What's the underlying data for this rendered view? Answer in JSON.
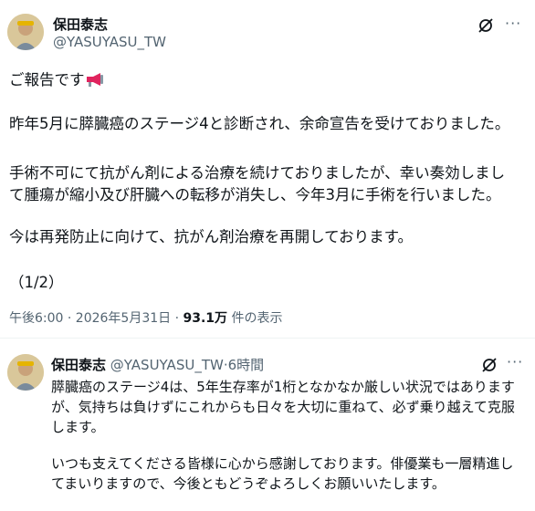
{
  "main_post": {
    "author_name": "保田泰志",
    "handle": "@YASUYASU_TW",
    "more_label": "···",
    "intro_text": "ご報告です",
    "intro_emoji_icon": "megaphone-icon",
    "lines": [
      "昨年5月に膵臓癌のステージ4と診断され、余命宣告を受けておりました。",
      "",
      "手術不可にて抗がん剤による治療を続けておりましたが、幸い奏効しまし",
      "て腫瘍が縮小及び肝臓への転移が消失し、今年3月に手術を行いました。",
      "",
      "今は再発防止に向けて、抗がん剤治療を再開しております。",
      "",
      "（1/2）"
    ],
    "timestamp": "午後6:00 · 2026年5月31日",
    "dot": "·",
    "views_count": "93.1万",
    "views_label": "件の表示"
  },
  "reply_post": {
    "author_name": "保田泰志",
    "handle": "@YASUYASU_TW",
    "dot": "·",
    "relative_time": "6時間",
    "more_label": "···",
    "lines": [
      "膵臓癌のステージ4は、5年生存率が1桁となかなか厳しい状況ではあります",
      "が、気持ちは負けずにこれからも日々を大切に重ねて、必ず乗り越えて克服",
      "します。",
      "",
      "いつも支えてくださる皆様に心から感謝しております。俳優業も一層精進し",
      "てまいりますので、今後ともどうぞよろしくお願いいたします。"
    ]
  },
  "colors": {
    "text": "#0f1419",
    "secondary": "#536471",
    "divider": "#eff3f4"
  }
}
